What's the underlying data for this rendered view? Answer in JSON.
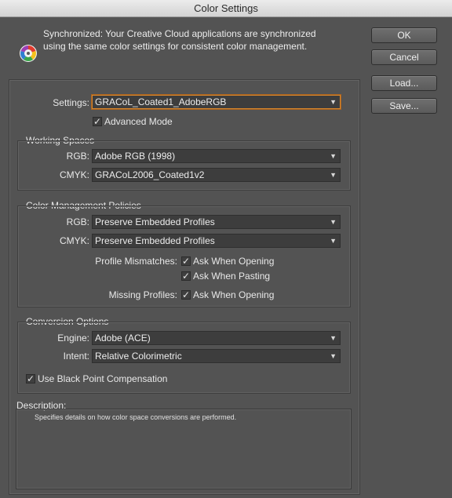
{
  "window": {
    "title": "Color Settings"
  },
  "sync": {
    "icon": "color-wheel-icon",
    "line1": "Synchronized: Your Creative Cloud applications are synchronized",
    "line2": "using the same color settings for consistent color management."
  },
  "buttons": {
    "ok": "OK",
    "cancel": "Cancel",
    "load": "Load...",
    "save": "Save..."
  },
  "settings": {
    "label": "Settings:",
    "value": "GRACoL_Coated1_AdobeRGB",
    "advanced_mode": {
      "label": "Advanced Mode",
      "checked": true
    }
  },
  "working_spaces": {
    "title": "Working Spaces",
    "rgb_label": "RGB:",
    "rgb_value": "Adobe RGB (1998)",
    "cmyk_label": "CMYK:",
    "cmyk_value": "GRACoL2006_Coated1v2"
  },
  "policies": {
    "title": "Color Management Policies",
    "rgb_label": "RGB:",
    "rgb_value": "Preserve Embedded Profiles",
    "cmyk_label": "CMYK:",
    "cmyk_value": "Preserve Embedded Profiles",
    "profile_mismatches_label": "Profile Mismatches:",
    "ask_when_opening": {
      "label": "Ask When Opening",
      "checked": true
    },
    "ask_when_pasting": {
      "label": "Ask When Pasting",
      "checked": true
    },
    "missing_profiles_label": "Missing Profiles:",
    "missing_ask_when_opening": {
      "label": "Ask When Opening",
      "checked": true
    }
  },
  "conversion": {
    "title": "Conversion Options",
    "engine_label": "Engine:",
    "engine_value": "Adobe (ACE)",
    "intent_label": "Intent:",
    "intent_value": "Relative Colorimetric",
    "black_point": {
      "label": "Use Black Point Compensation",
      "checked": true
    }
  },
  "description": {
    "label": "Description:",
    "text": "Specifies details on how color space conversions are performed."
  },
  "colors": {
    "focus_accent": "#d9872c",
    "dialog_bg": "#535353",
    "field_bg": "#3d3d3d"
  }
}
